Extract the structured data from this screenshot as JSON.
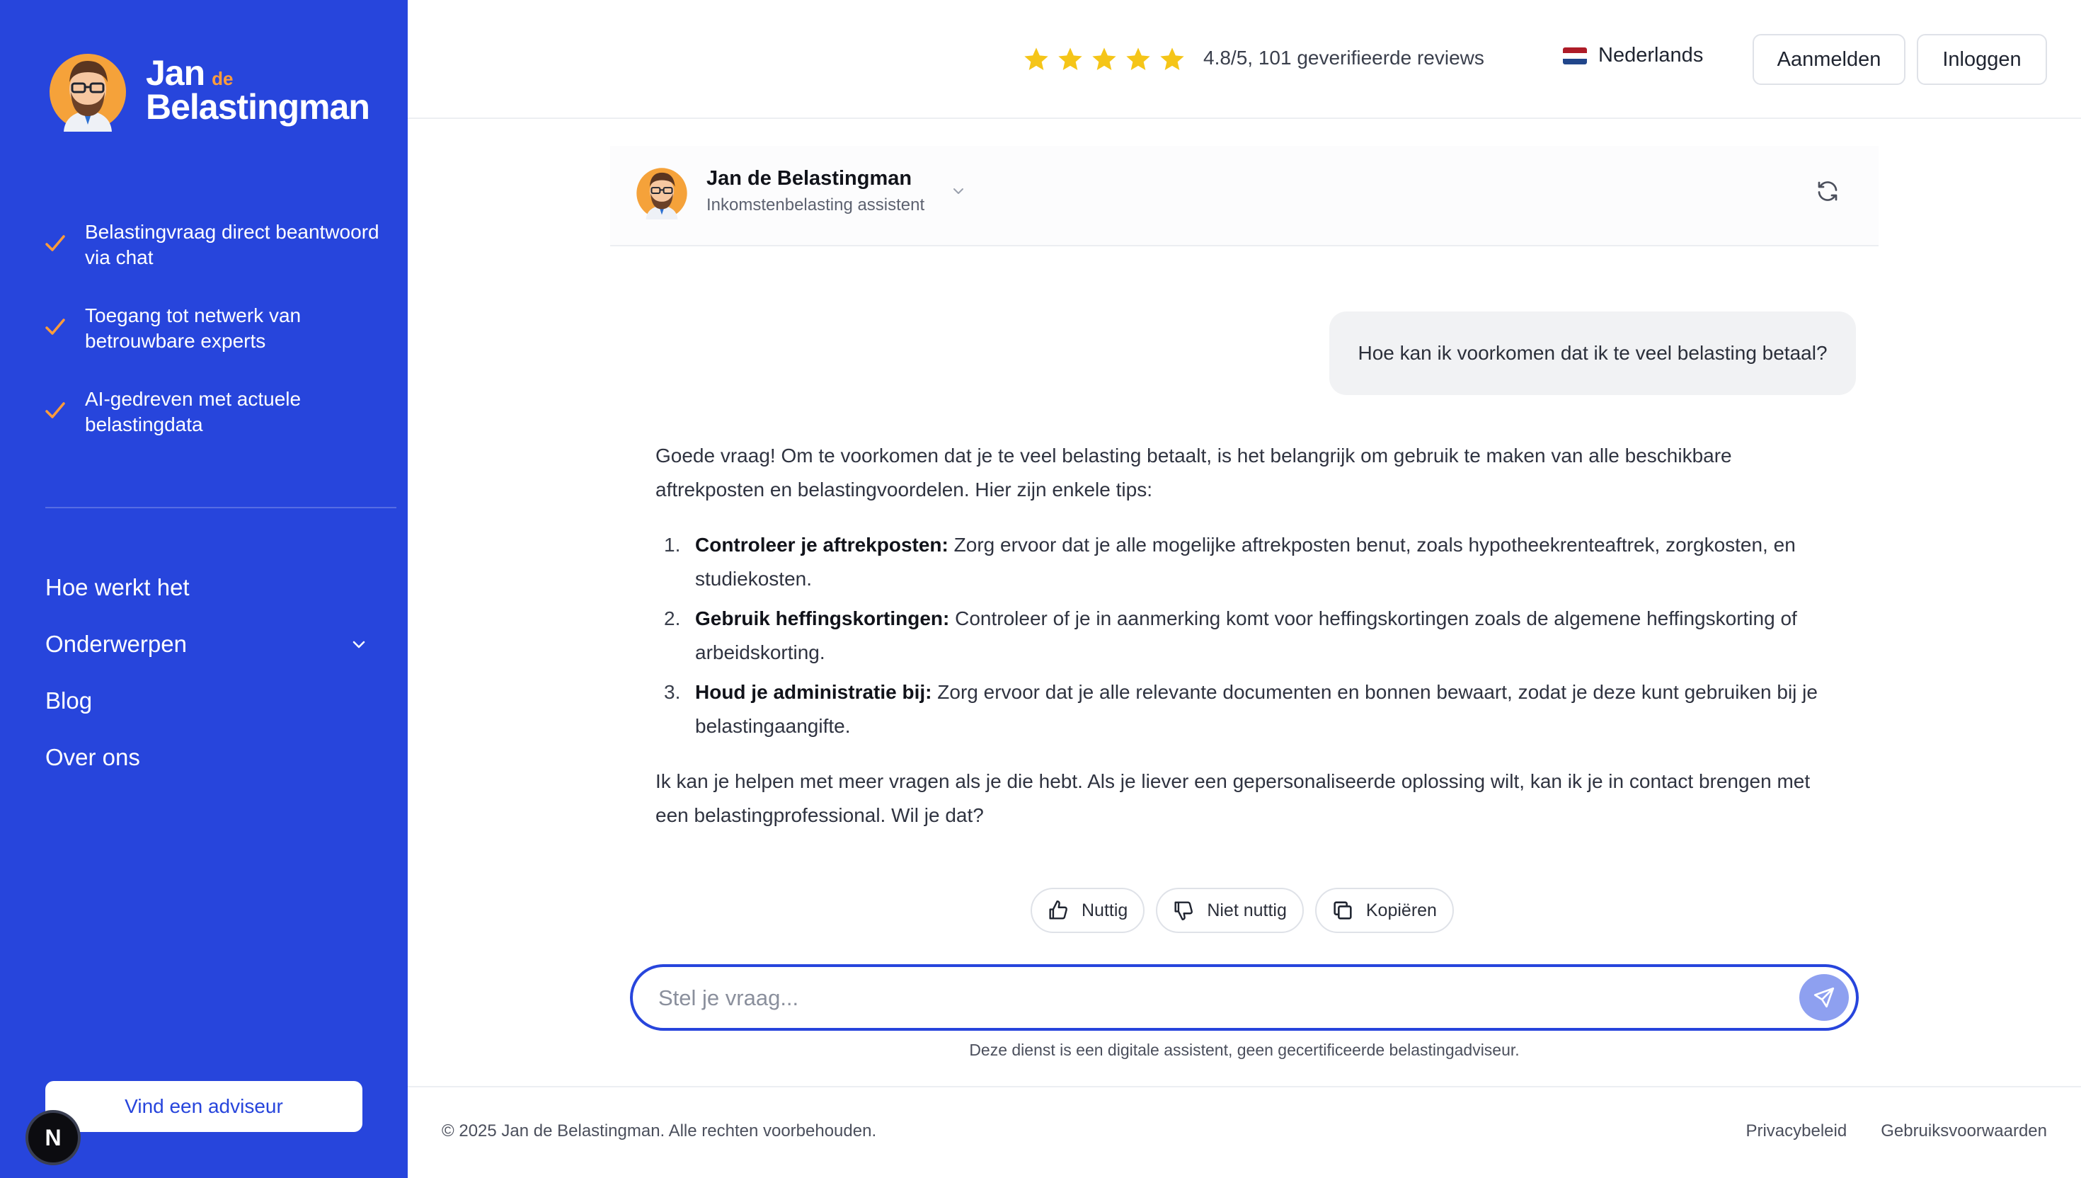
{
  "brand": {
    "name_line1": "Jan",
    "name_de": "de",
    "name_line2": "Belastingman"
  },
  "features": [
    {
      "text": "Belastingvraag direct beantwoord via chat"
    },
    {
      "text": "Toegang tot netwerk van betrouwbare experts"
    },
    {
      "text": "AI-gedreven met actuele belastingdata"
    }
  ],
  "nav": [
    {
      "label": "Hoe werkt het",
      "has_dropdown": false
    },
    {
      "label": "Onderwerpen",
      "has_dropdown": true
    },
    {
      "label": "Blog",
      "has_dropdown": false
    },
    {
      "label": "Over ons",
      "has_dropdown": false
    }
  ],
  "sidebar_cta": "Vind een adviseur",
  "badge": "N",
  "header": {
    "rating_stars": 5,
    "rating_text": "4.8/5, 101 geverifieerde reviews",
    "language": "Nederlands",
    "signup": "Aanmelden",
    "login": "Inloggen"
  },
  "chat": {
    "bot_name": "Jan de Belastingman",
    "bot_role": "Inkomstenbelasting assistent",
    "user_message": "Hoe kan ik voorkomen dat ik te veel belasting betaal?",
    "answer_intro": "Goede vraag! Om te voorkomen dat je te veel belasting betaalt, is het belangrijk om gebruik te maken van alle beschikbare aftrekposten en belastingvoordelen. Hier zijn enkele tips:",
    "tips": [
      {
        "num": "1.",
        "title": "Controleer je aftrekposten:",
        "text": " Zorg ervoor dat je alle mogelijke aftrekposten benut, zoals hypotheekrenteaftrek, zorgkosten, en studiekosten."
      },
      {
        "num": "2.",
        "title": "Gebruik heffingskortingen:",
        "text": " Controleer of je in aanmerking komt voor heffingskortingen zoals de algemene heffingskorting of arbeidskorting."
      },
      {
        "num": "3.",
        "title": "Houd je administratie bij:",
        "text": " Zorg ervoor dat je alle relevante documenten en bonnen bewaart, zodat je deze kunt gebruiken bij je belastingaangifte."
      }
    ],
    "answer_outro": "Ik kan je helpen met meer vragen als je die hebt. Als je liever een gepersonaliseerde oplossing wilt, kan ik je in contact brengen met een belastingprofessional. Wil je dat?",
    "actions": {
      "useful": "Nuttig",
      "not_useful": "Niet nuttig",
      "copy": "Kopiëren"
    },
    "input_placeholder": "Stel je vraag...",
    "input_value": "",
    "disclaimer": "Deze dienst is een digitale assistent, geen gecertificeerde belastingadviseur."
  },
  "footer": {
    "copyright": "© 2025 Jan de Belastingman. Alle rechten voorbehouden.",
    "privacy": "Privacybeleid",
    "terms": "Gebruiksvoorwaarden"
  },
  "colors": {
    "primary": "#2745dc",
    "accent_orange": "#ff9c3a",
    "star": "#f5c518",
    "send_button": "#8ea0f0"
  }
}
